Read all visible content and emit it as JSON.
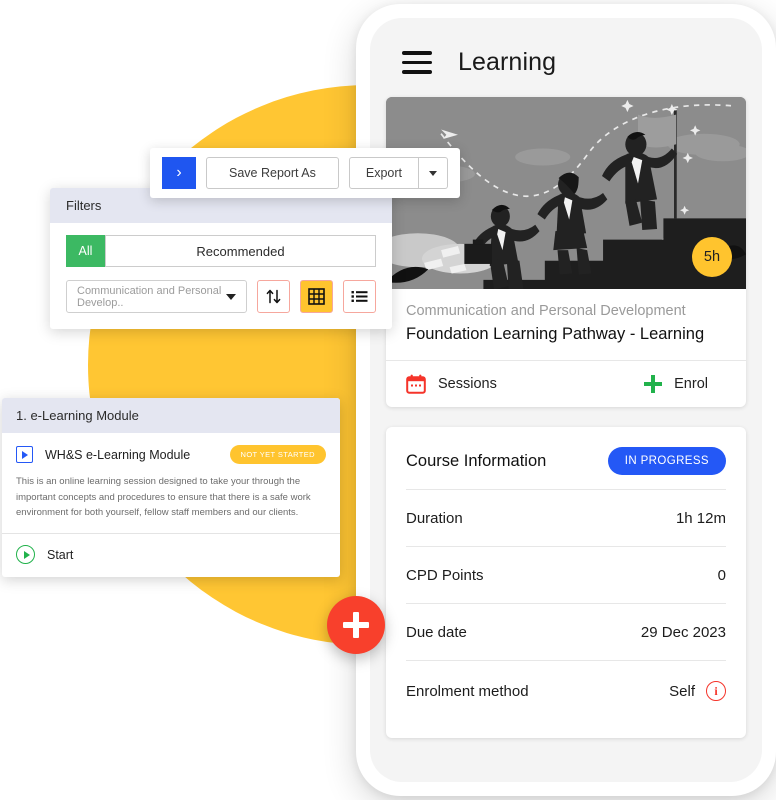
{
  "decor": {
    "circle_color": "#FFC633",
    "fab": {
      "icon": "plus-icon",
      "color": "#f8402c"
    }
  },
  "phone": {
    "appbar": {
      "menu_icon": "hamburger-menu-icon",
      "title": "Learning"
    },
    "course_card": {
      "hero": {
        "image_alt": "team climbing stairs to flag illustration",
        "duration_badge": "5h"
      },
      "category": "Communication and Personal Development",
      "title": "Foundation Learning Pathway - Learning",
      "actions": [
        {
          "icon": "calendar-icon",
          "label": "Sessions"
        },
        {
          "icon": "plus-icon",
          "label": "Enrol"
        }
      ]
    },
    "info_card": {
      "heading": "Course Information",
      "status": "IN PROGRESS",
      "status_color": "#2458f6",
      "rows": [
        {
          "label": "Duration",
          "value": "1h 12m"
        },
        {
          "label": "CPD Points",
          "value": "0"
        },
        {
          "label": "Due date",
          "value": "29 Dec 2023"
        },
        {
          "label": "Enrolment method",
          "value": "Self",
          "info_icon": "info-circle-icon"
        }
      ]
    }
  },
  "toolbar": {
    "chevron_label": "›",
    "save_report_as": "Save Report As",
    "export": "Export",
    "caret_icon": "caret-down-icon"
  },
  "filters": {
    "title": "Filters",
    "all_label": "All",
    "all_color": "#3cb963",
    "recommended_label": "Recommended",
    "category_select": "Communication and Personal Develop..",
    "view_buttons": [
      {
        "icon": "sort-icon",
        "active": false
      },
      {
        "icon": "grid-view-icon",
        "active": true
      },
      {
        "icon": "list-view-icon",
        "active": false
      }
    ]
  },
  "module": {
    "header": "1. e-Learning Module",
    "name": "WH&S e-Learning Module",
    "status_badge": "NOT YET STARTED",
    "description": "This is an online learning session designed to take your through the important concepts and procedures to ensure that there is a safe work environment for both yourself, fellow staff members and our clients.",
    "start_label": "Start"
  }
}
